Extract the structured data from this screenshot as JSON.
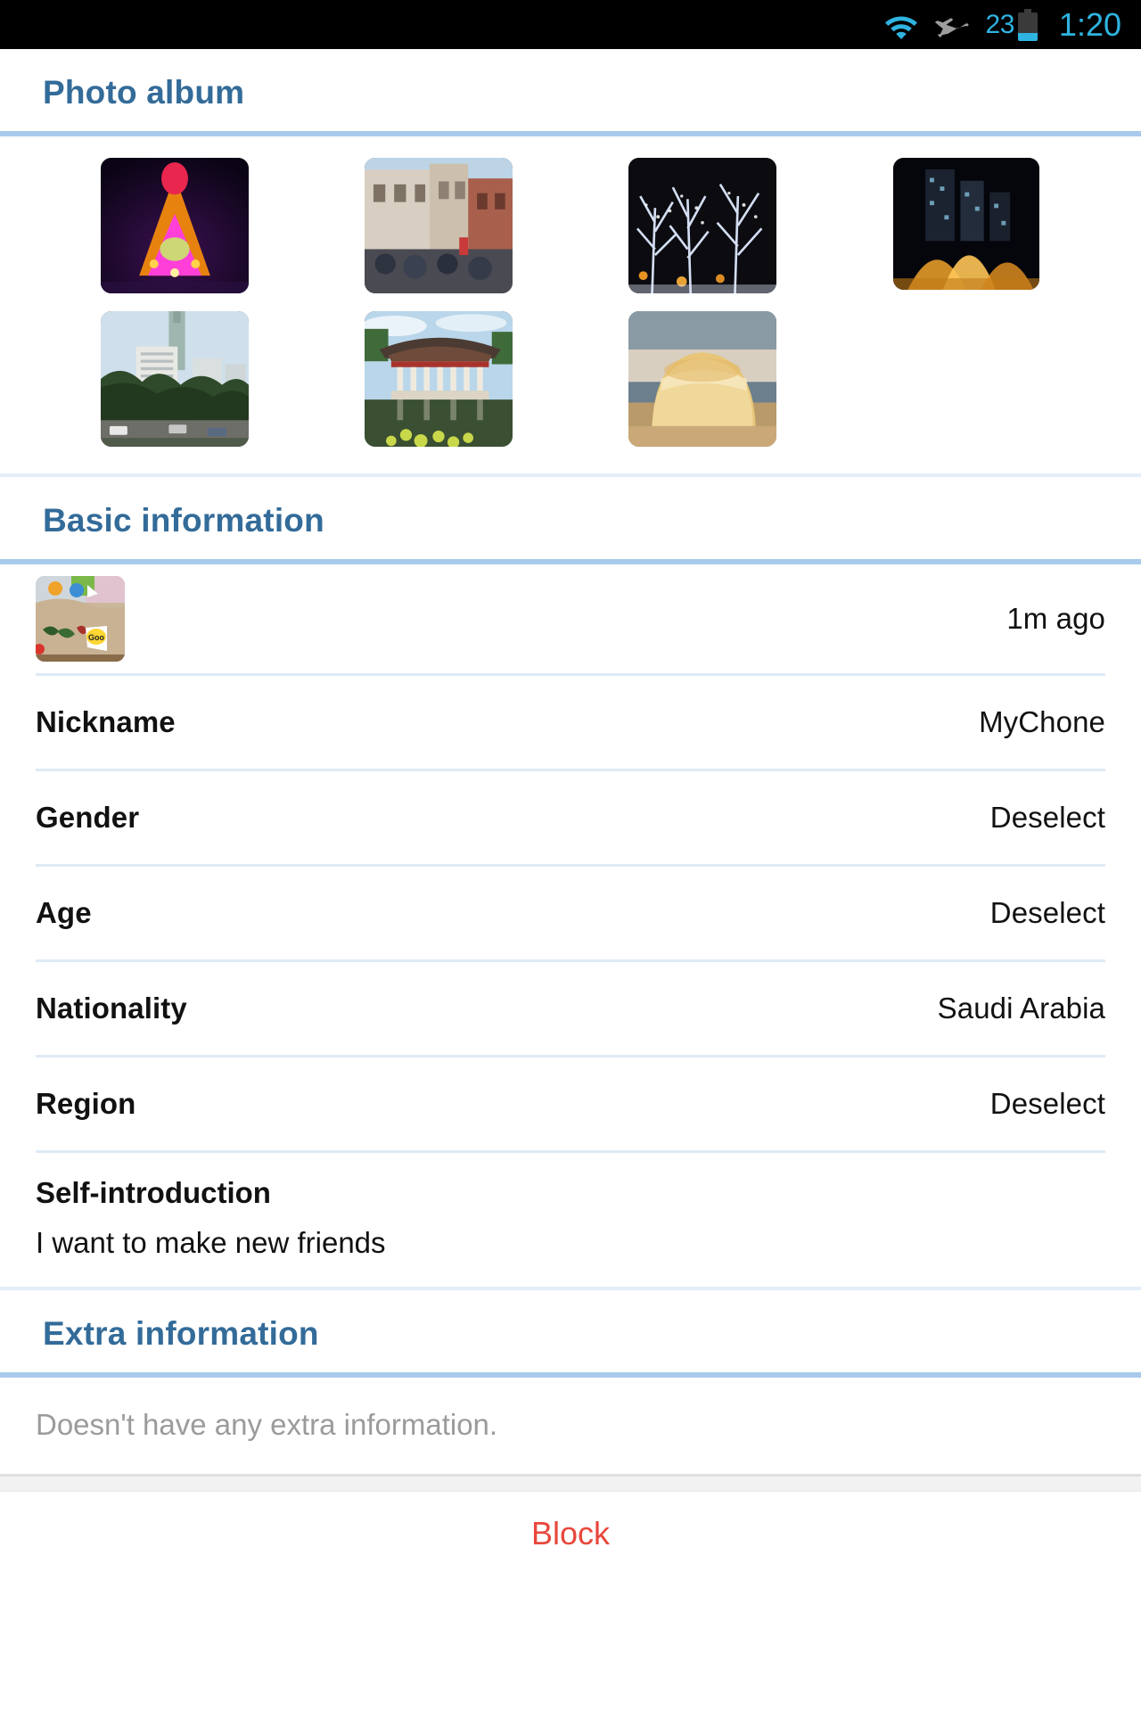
{
  "statusbar": {
    "wifi_icon": "wifi-icon",
    "airplane_icon": "airplane-mode-icon",
    "battery_percent": "23",
    "battery_icon": "battery-icon",
    "time": "1:20",
    "accent_color": "#2fb3e0",
    "background_color": "#000000"
  },
  "theme": {
    "header_blue": "#336b99",
    "rule_blue": "#a9cbeb",
    "divider": "#dfeaf6",
    "danger_red": "#e8473c",
    "muted_text": "#9b9b9b"
  },
  "photo_album": {
    "title": "Photo album",
    "photos": [
      {
        "name": "christmas-light-tree-photo",
        "alt": "Illuminated pink and orange light sculpture at night"
      },
      {
        "name": "street-crowd-photo",
        "alt": "Crowded old street with historic buildings"
      },
      {
        "name": "light-trees-photo",
        "alt": "Trees covered in white fairy lights at night"
      },
      {
        "name": "night-fountain-photo",
        "alt": "City skyscrapers with golden fountain at night"
      },
      {
        "name": "taipei-101-park-photo",
        "alt": "Park with tall tower in the background"
      },
      {
        "name": "korean-pavilion-photo",
        "alt": "Traditional pavilion reflected in a pond"
      },
      {
        "name": "bread-loaf-photo",
        "alt": "Loaf of bread on a plate"
      }
    ]
  },
  "basic_information": {
    "title": "Basic information",
    "avatar": {
      "name": "profile-avatar",
      "alt": "Colorful sticker artwork avatar"
    },
    "last_seen": "1m ago",
    "fields": [
      {
        "label": "Nickname",
        "value": "MyChone"
      },
      {
        "label": "Gender",
        "value": "Deselect"
      },
      {
        "label": "Age",
        "value": "Deselect"
      },
      {
        "label": "Nationality",
        "value": "Saudi Arabia"
      },
      {
        "label": "Region",
        "value": "Deselect"
      }
    ],
    "self_introduction": {
      "label": "Self-introduction",
      "text": "I want to make new friends"
    }
  },
  "extra_information": {
    "title": "Extra information",
    "empty_text": "Doesn't have any extra information."
  },
  "footer": {
    "block_label": "Block"
  }
}
